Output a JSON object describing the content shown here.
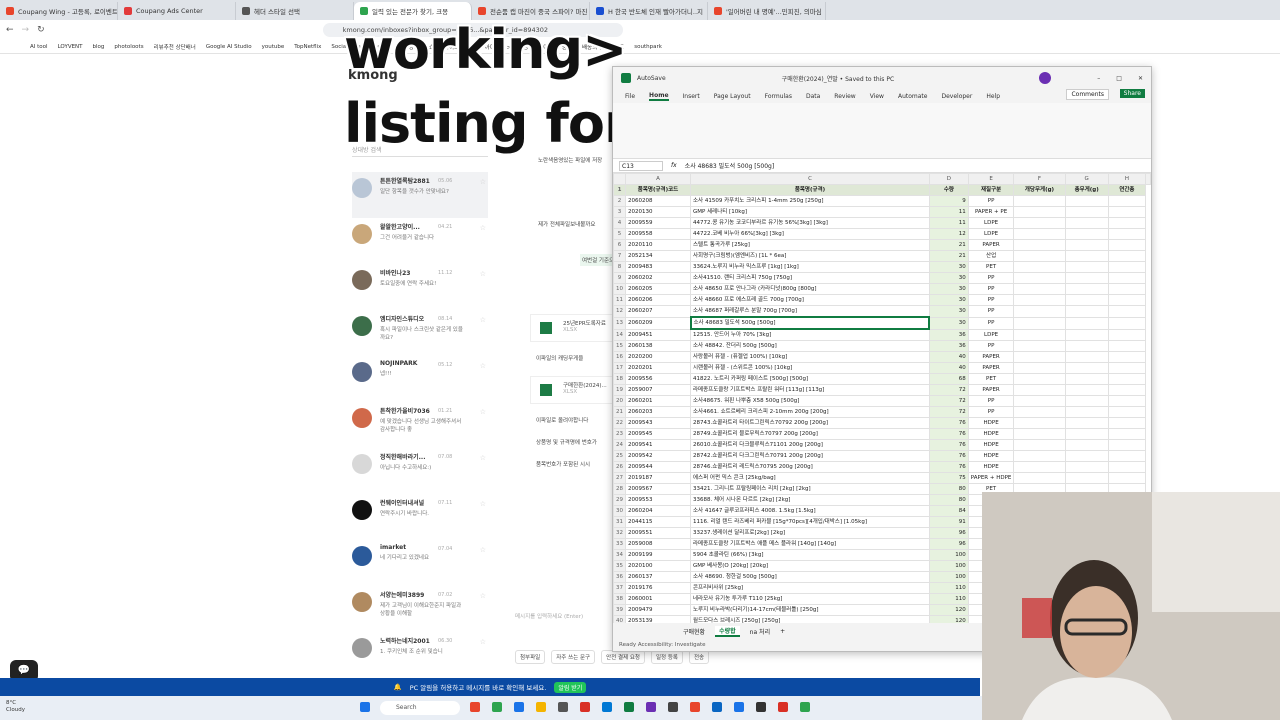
{
  "browser": {
    "tabs": [
      {
        "label": "Coupang Wing - 고등록, 로이벤트",
        "color": "#e8452c"
      },
      {
        "label": "Coupang Ads Center",
        "color": "#e23a3a"
      },
      {
        "label": "헤더 스타일 선택",
        "color": "#555"
      },
      {
        "label": "일력 있는 전문가 찾기, 크몽",
        "color": "#2ea44f",
        "active": true
      },
      {
        "label": "전순품 캡 마진이 중국 스파이? 마진",
        "color": "#e8452c"
      },
      {
        "label": "H 한국 반도체 인재 빨아가더니..지",
        "color": "#1a4fd1"
      },
      {
        "label": "'일어버린 내 명예'...민피진, 의마심",
        "color": "#e8452c"
      }
    ],
    "url": "kmong.com/inboxes?inbox_group=5006...&partner_id=894302",
    "bookmarks": [
      "AI tool",
      "LOYVENT",
      "blog",
      "photoloots",
      "리뷰추천 상단배너",
      "Google AI Studio",
      "youtube",
      "TopNetflix",
      "Social & Influencers",
      "URL 링크",
      "쇼핑몰사이트 : 네이",
      "아이보스 > 마케팅",
      "단어 찾기 중복",
      "배송의 통드백스트",
      "southpark"
    ]
  },
  "overlay": {
    "line1": "working>",
    "line2": "listing for online selling"
  },
  "kmong": {
    "logo": "kmong",
    "search_placeholder": "상대방 검색",
    "chats": [
      {
        "name": "튼튼한열록탐2881",
        "time": "05.06",
        "msg": "일단 항목을 갯수가 안맞네요?",
        "color": "#b9c6d6",
        "selected": true
      },
      {
        "name": "왈왈한고양이...",
        "time": "04.21",
        "msg": "그건 어려울거 같습니다",
        "color": "#c9a77a"
      },
      {
        "name": "비바인나23",
        "time": "11.12",
        "msg": "토요일중에 연락 주세요!",
        "color": "#7a6a5a"
      },
      {
        "name": "엠디자인스튜디오",
        "time": "08.14",
        "msg": "혹시 파일이나 스크린샷 같은게 있을까요?",
        "color": "#3c6e4a"
      },
      {
        "name": "NOJINPARK",
        "time": "05.12",
        "msg": "넵!!!",
        "color": "#5a6a8a"
      },
      {
        "name": "튼착한가을비7036",
        "time": "01.21",
        "msg": "예 맞겠습니다 선생님 고생해주셔서 감사합니다 좋",
        "color": "#d0694a"
      },
      {
        "name": "정직한해바라기...",
        "time": "07.08",
        "msg": "아닙니다 수고하세요:)",
        "color": "#d8d8d8"
      },
      {
        "name": "런웨이인터내셔널",
        "time": "07.11",
        "msg": "연락주시기 바랍니다.",
        "color": "#111"
      },
      {
        "name": "imarket",
        "time": "07.04",
        "msg": "네 기다리고 있겠네요",
        "color": "#2b5a9a"
      },
      {
        "name": "서양는에미3899",
        "time": "07.02",
        "msg": "제가 고객님이 이해요한준지 파일과 상황을 이해할",
        "color": "#b08a60"
      },
      {
        "name": "노력하는네지2001",
        "time": "06.30",
        "msg": "1. 쿠키인체 조 순위 및습니",
        "color": "#9a9a9a"
      }
    ],
    "pane": {
      "b1": "노란색음영있는 파일에 저장",
      "b2": "제가 전체파일보내볼까요",
      "b3": "여번걸 기준으로 혹시 품목이",
      "file1": "25년EPR도록자료",
      "file1ext": "XLSX",
      "b4": "이파일의 캐딩무게을",
      "file2": "구매한환(2024)...",
      "file2ext": "XLSX",
      "b5": "이파일로 올려야합니다",
      "b6": "상품명 및 규격명에 번호가",
      "b7": "품목번호가 포함된 시시",
      "input_placeholder": "메시지를 입력하세요 (Enter)",
      "buttons": [
        "첨부파일",
        "자주 쓰는 문구",
        "안전 결제 요청",
        "일정 등록",
        "전송"
      ]
    }
  },
  "excel": {
    "title": "구매한환(2024)_연말 • Saved to this PC",
    "autosave": "AutoSave",
    "menu": [
      "File",
      "Home",
      "Insert",
      "Page Layout",
      "Formulas",
      "Data",
      "Review",
      "View",
      "Automate",
      "Developer",
      "Help"
    ],
    "active_menu": "Home",
    "comments": "Comments",
    "share": "Share",
    "namebox": "C13",
    "formula": "소사 48683 밀도석 500g [500g]",
    "columns": [
      "A",
      "C",
      "D",
      "E",
      "F",
      "G",
      "H"
    ],
    "headers": [
      "품목명(규격)코드",
      "품목명(규격)",
      "수량",
      "재질구분",
      "개당무게(g)",
      "총무게(g)",
      "연간총"
    ],
    "rows": [
      [
        "2060208",
        "소사 41509 카푸치노 크리스피 1-4mm 250g [250g]",
        "9",
        "PP"
      ],
      [
        "2020130",
        "GMP 세레나티 [10kg]",
        "11",
        "PAPER + PE"
      ],
      [
        "2009559",
        "44772.콩 유기농 코코디부라르 유기농 56%[3kg] [3kg]",
        "11",
        "LDPE"
      ],
      [
        "2009558",
        "44722.코베 비누아 66%[3kg] [3kg]",
        "12",
        "LDPE"
      ],
      [
        "2020110",
        "스텔트 통곡가루 [25kg]",
        "21",
        "PAPER"
      ],
      [
        "2052134",
        "사회명구(크림벙)(엠엔비즈) [1L * 6ea]",
        "21",
        "산업"
      ],
      [
        "2009483",
        "33624.노루지 비누라 믹스프루 [1kg] [1kg]",
        "30",
        "PET"
      ],
      [
        "2060202",
        "소사41510. 랜티 크리스피 750g [750g]",
        "30",
        "PP"
      ],
      [
        "2060205",
        "소사 48650 프로 안나그라 (카라디넛)800g [800g]",
        "30",
        "PP"
      ],
      [
        "2060206",
        "소사 48660 프로 에스프레 골드 700g [700g]",
        "30",
        "PP"
      ],
      [
        "2060207",
        "소사 48687 퍼레갈루스 분말 700g [700g]",
        "30",
        "PP"
      ],
      [
        "2060209",
        "소사 48683 밀도석 500g [500g]",
        "30",
        "PP"
      ],
      [
        "2009451",
        "12515. 안드어 누아 70% [3kg]",
        "36",
        "LDPE"
      ],
      [
        "2060138",
        "소사 48842. 잔더리 500g [500g]",
        "36",
        "PP"
      ],
      [
        "2020200",
        "사랑볼러 퓨젤 - (퓨젤업 100%) [10kg]",
        "40",
        "PAPER"
      ],
      [
        "2020201",
        "시랜볼러 퓨젤 - (스위트콘 100%) [10kg]",
        "40",
        "PAPER"
      ],
      [
        "2009556",
        "41822. 노트리 카퍼링 페이스트 [500g] [500g]",
        "68",
        "PET"
      ],
      [
        "2059007",
        "라메종프도클랑 기프트박스 프랄린 워터 [113g] [113g]",
        "72",
        "PAPER"
      ],
      [
        "2060201",
        "소사48675. 워핀 나뿌층 X58 500g [500g]",
        "72",
        "PP"
      ],
      [
        "2060203",
        "소사4661. 쇼트르베리 크리스피 2-10mm 200g [200g]",
        "72",
        "PP"
      ],
      [
        "2009543",
        "28743.쇼콜라트리 타이트그린릭스70792 200g [200g]",
        "76",
        "HDPE"
      ],
      [
        "2009545",
        "28749.쇼콜라트리 블로무릭스70797 200g [200g]",
        "76",
        "HDPE"
      ],
      [
        "2009541",
        "26010.쇼콜라트리 다크블루릭스71101 200g [200g]",
        "76",
        "HDPE"
      ],
      [
        "2009542",
        "28742.쇼콜라트리 다크그린릭스70791 200g [200g]",
        "76",
        "HDPE"
      ],
      [
        "2009544",
        "28746.쇼콜라트리 레드릭스70795 200g [200g]",
        "76",
        "HDPE"
      ],
      [
        "2019187",
        "에스퍼 어펀 믹스 콘크 [25kg/bag]",
        "75",
        "PAPER + HDPE"
      ],
      [
        "2009567",
        "33421. 그리니트 프랄링페이스 리치 [2kg] [2kg]",
        "80",
        "PET"
      ],
      [
        "2009553",
        "33688. 체어 시나몬 다르트 [2kg] [2kg]",
        "80",
        ""
      ],
      [
        "2060204",
        "소사 41647 글루코프라피스 4008. 1.5kg [1.5kg]",
        "84",
        ""
      ],
      [
        "2044115",
        "1116. 리얼 텐드 라즈베리 퍼카블 [15g*70pcs][4개입/대박스] [1.05kg]",
        "91",
        ""
      ],
      [
        "2009551",
        "33237.생레이션 달리프로[2kg] [2kg]",
        "96",
        ""
      ],
      [
        "2059008",
        "라메종프도클랑 기프트박스 애플 메스 플라워 [140g] [140g]",
        "96",
        ""
      ],
      [
        "2009199",
        "5904 초콜라틴 (66%) [3kg]",
        "100",
        ""
      ],
      [
        "2020100",
        "GMP 베사몽(O [20kg] [20kg]",
        "100",
        ""
      ],
      [
        "2060137",
        "소사 48690. 청한걸 500g [500g]",
        "100",
        ""
      ],
      [
        "2019176",
        "콘프리비사위 [25kg]",
        "110",
        "PA"
      ],
      [
        "2060001",
        "네라모사 유기농 투가루 T110 [25kg]",
        "110",
        ""
      ],
      [
        "2009479",
        "노루지 비누라박(다리기)14-17cm(테블러틀) [250g]",
        "120",
        ""
      ],
      [
        "2053139",
        "월드모다스 브레시즈 [250g] [250g]",
        "120",
        ""
      ]
    ],
    "sheets": [
      "구매현황",
      "수량합",
      "na 처리"
    ],
    "active_sheet": "수량합",
    "status": "Ready   Accessibility: Investigate"
  },
  "notification": {
    "text": "PC 알림을 허용하고 메시지를 바로 확인해 보세요.",
    "button": "알림 받기"
  },
  "taskbar": {
    "temp": "8°C",
    "weather": "Cloudy",
    "search": "Search"
  }
}
